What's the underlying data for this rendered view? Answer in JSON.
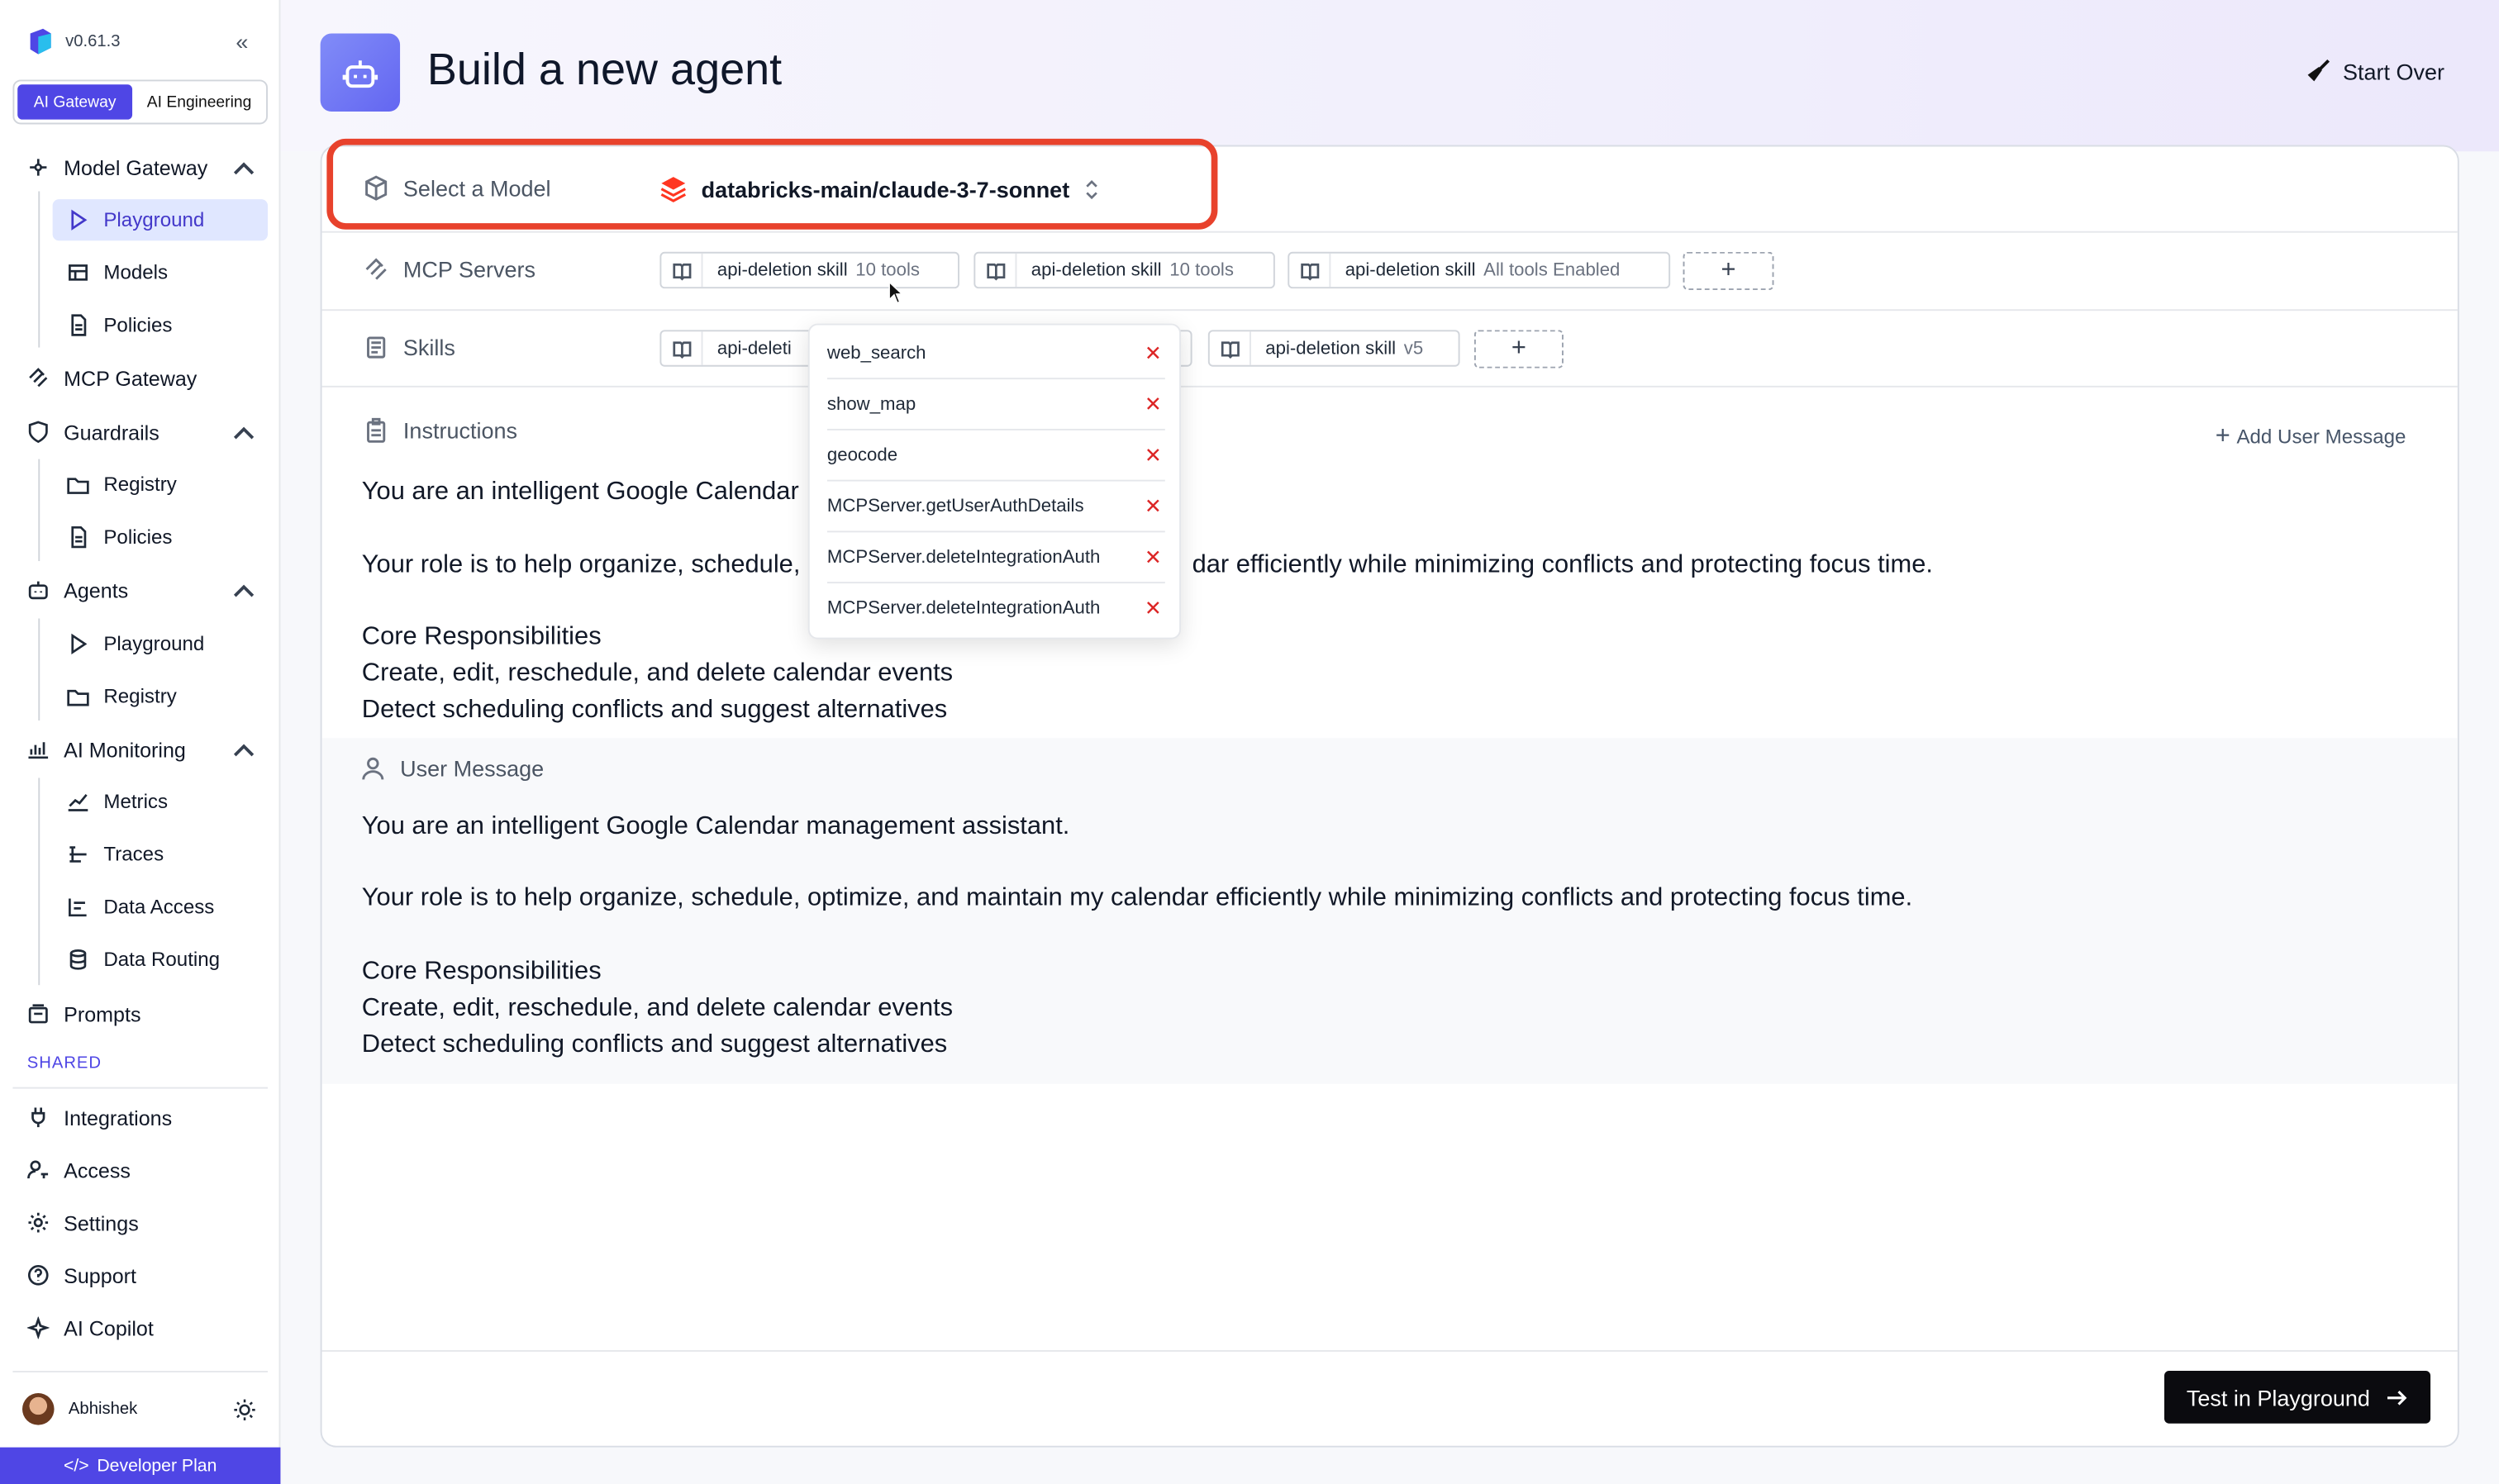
{
  "app": {
    "version": "v0.61.3",
    "tabs": [
      "AI Gateway",
      "AI Engineering"
    ],
    "active_tab": "AI Gateway"
  },
  "sidebar": {
    "model_gateway": "Model Gateway",
    "mg_items": [
      "Playground",
      "Models",
      "Policies"
    ],
    "mcp_gateway": "MCP Gateway",
    "guardrails": "Guardrails",
    "gr_items": [
      "Registry",
      "Policies"
    ],
    "agents": "Agents",
    "ag_items": [
      "Playground",
      "Registry"
    ],
    "ai_monitoring": "AI Monitoring",
    "mon_items": [
      "Metrics",
      "Traces",
      "Data Access",
      "Data Routing"
    ],
    "prompts": "Prompts",
    "shared_label": "SHARED",
    "shared_items": [
      "Integrations",
      "Access",
      "Settings",
      "Support",
      "AI Copilot"
    ],
    "user": "Abhishek",
    "plan": "Developer Plan"
  },
  "header": {
    "title": "Build a new agent",
    "start_over": "Start Over"
  },
  "form": {
    "model_label": "Select a Model",
    "model_value": "databricks-main/claude-3-7-sonnet",
    "mcp_label": "MCP Servers",
    "mcp_chips": [
      {
        "name": "api-deletion skill",
        "meta": "10 tools"
      },
      {
        "name": "api-deletion skill",
        "meta": "10 tools"
      },
      {
        "name": "api-deletion skill",
        "meta": "All tools Enabled"
      }
    ],
    "skills_label": "Skills",
    "skill_chip_1": "api-deleti",
    "skill_chip_2": {
      "name": "api-deletion skill",
      "meta": "v5"
    },
    "add_symbol": "+",
    "instructions_label": "Instructions",
    "add_user_message": "Add User Message",
    "instructions_lines": [
      "You are an intelligent Google Calendar",
      "Your role is to help organize, schedule,",
      "dar efficiently while minimizing conflicts and protecting focus time.",
      "Core Responsibilities",
      "Create, edit, reschedule, and delete calendar events",
      "Detect scheduling conflicts and suggest alternatives"
    ],
    "user_message_label": "User Message",
    "user_message_lines": [
      "You are an intelligent Google Calendar management assistant.",
      "Your role is to help organize, schedule, optimize, and maintain my calendar efficiently while minimizing conflicts and protecting focus time.",
      "Core Responsibilities",
      "Create, edit, reschedule, and delete calendar events",
      "Detect scheduling conflicts and suggest alternatives"
    ],
    "test_button": "Test in Playground"
  },
  "tools_popup": [
    "web_search",
    "show_map",
    "geocode",
    "MCPServer.getUserAuthDetails",
    "MCPServer.deleteIntegrationAuth",
    "MCPServer.deleteIntegrationAuth"
  ],
  "colors": {
    "accent": "#4f46e5",
    "highlight": "#e8422c",
    "remove": "#dc2626"
  }
}
